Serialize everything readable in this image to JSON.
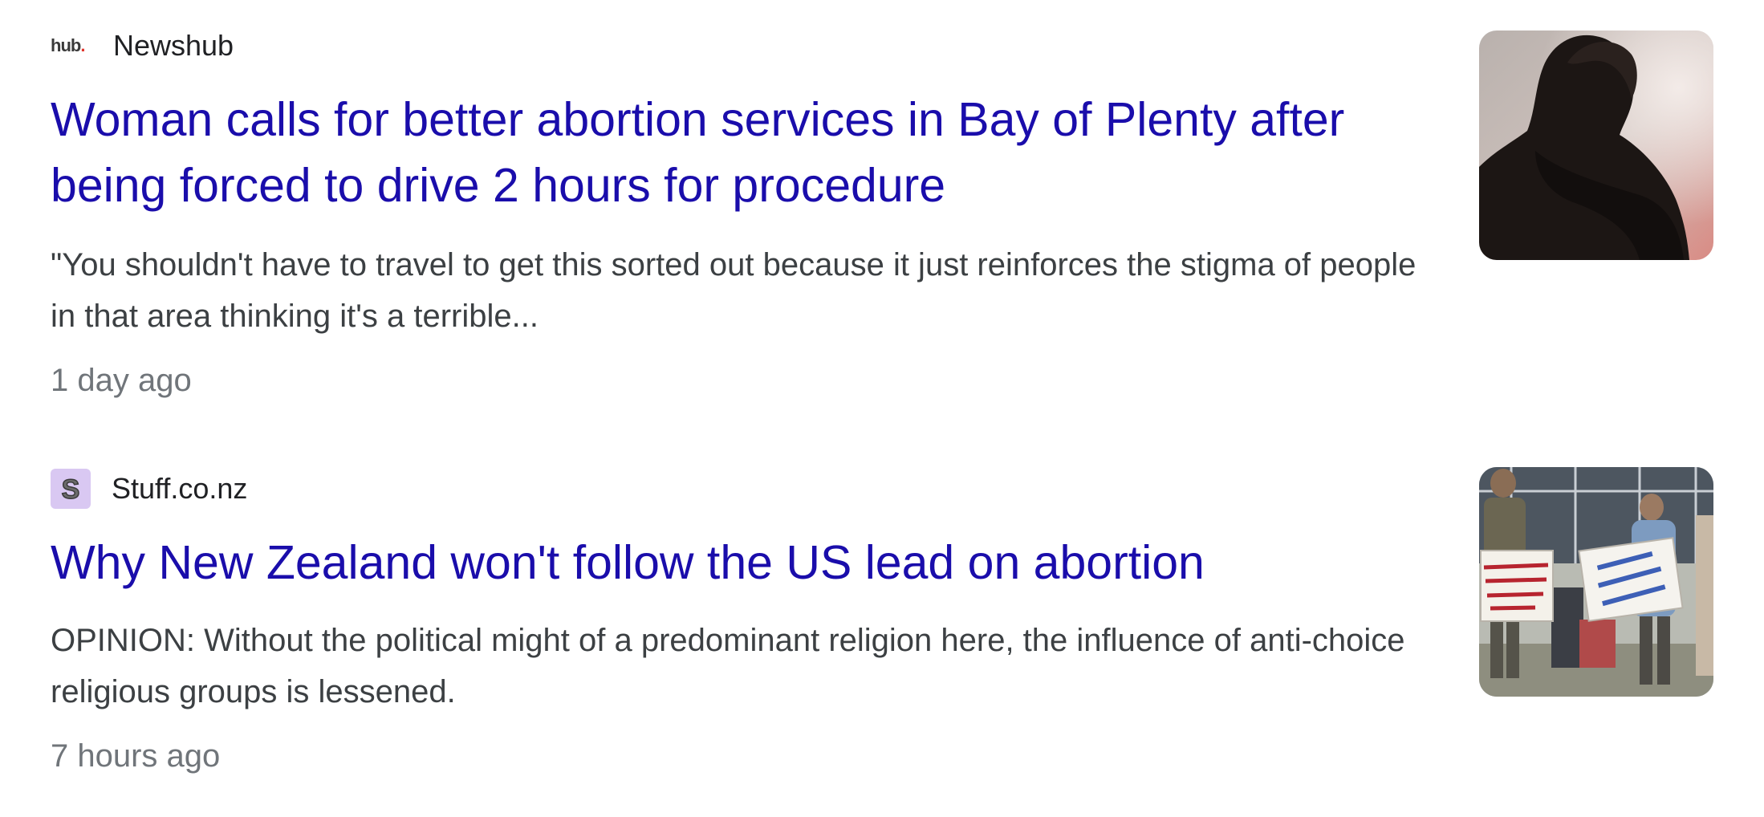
{
  "results": [
    {
      "source": {
        "logo_text": "hub",
        "logo_dot": ".",
        "name": "Newshub"
      },
      "headline": "Woman calls for better abortion services in Bay of Plenty after being forced to drive 2 hours for procedure",
      "snippet": "\"You shouldn't have to travel to get this sorted out because it just reinforces the stigma of people in that area thinking it's a terrible...",
      "time": "1 day ago",
      "thumbnail_icon": "silhouette-photo"
    },
    {
      "source": {
        "logo_text": "S",
        "name": "Stuff.co.nz"
      },
      "headline": "Why New Zealand won't follow the US lead on abortion",
      "snippet": "OPINION: Without the political might of a predominant religion here, the influence of anti-choice religious groups is lessened.",
      "time": "7 hours ago",
      "thumbnail_icon": "protest-photo"
    }
  ],
  "colors": {
    "headline": "#1a0dab",
    "snippet": "#3c4043",
    "timestamp": "#70757a",
    "source": "#202124",
    "stuff_logo_bg": "#d9c8f2"
  }
}
